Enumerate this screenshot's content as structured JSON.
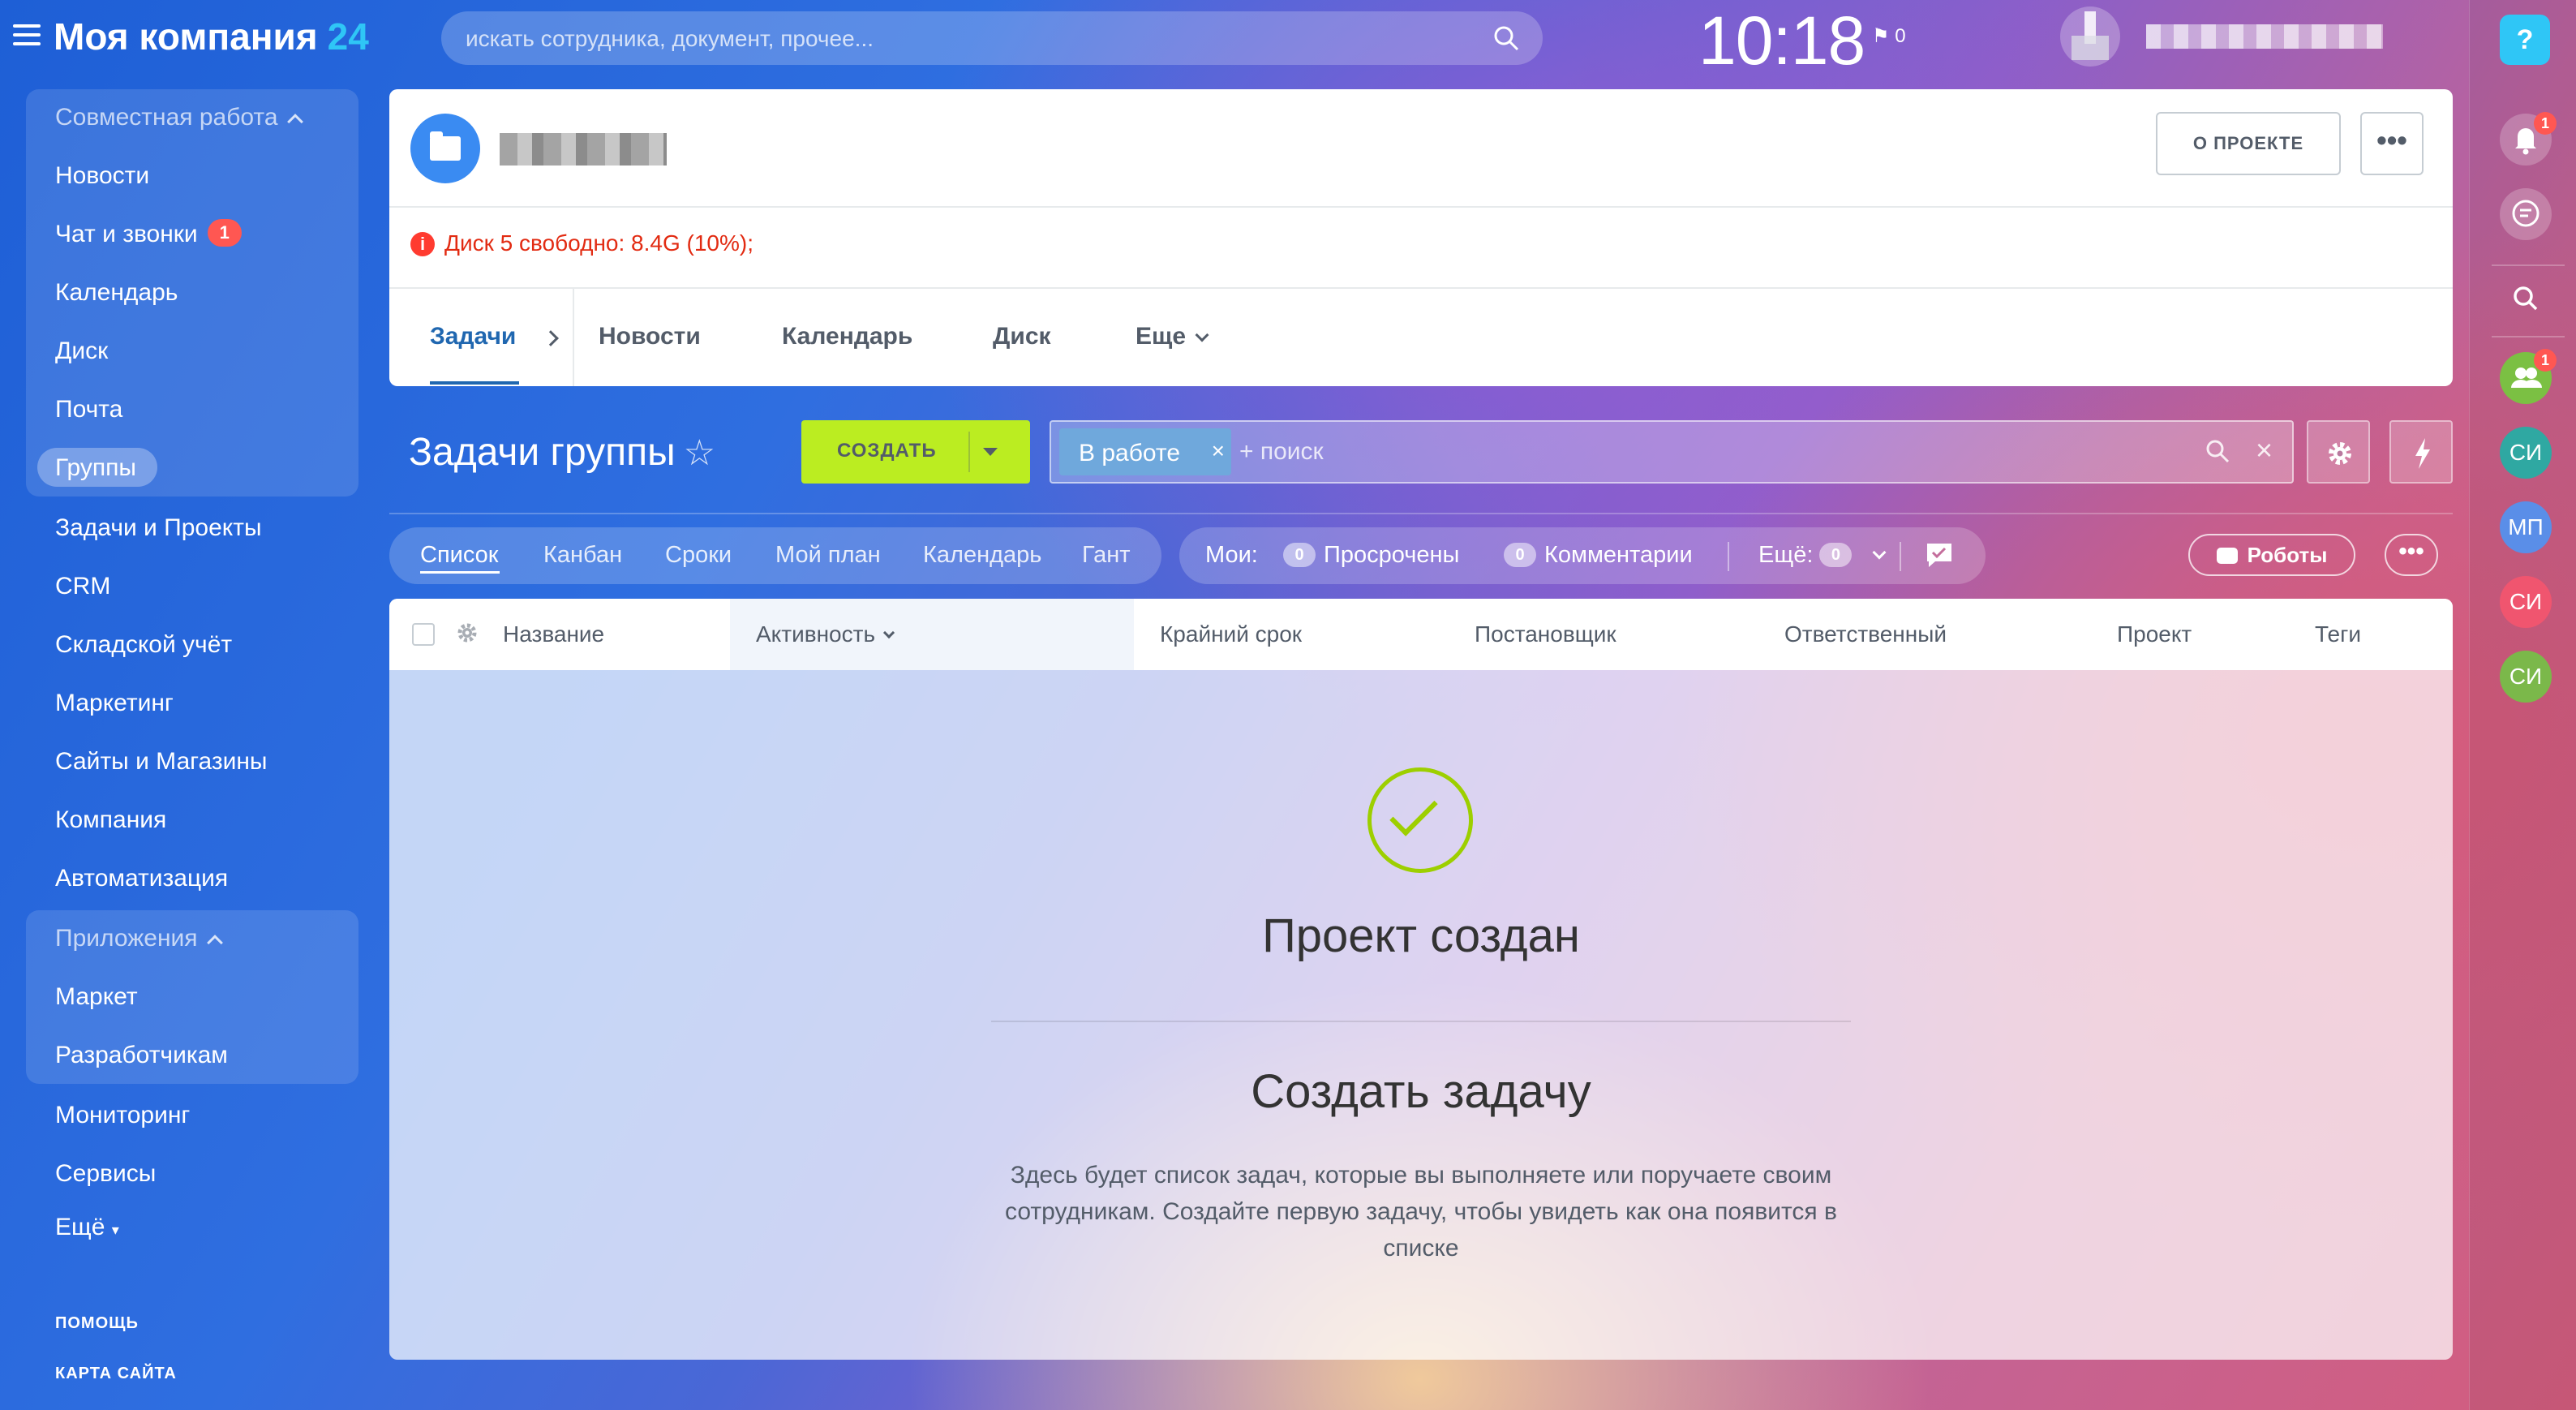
{
  "header": {
    "logo": "Моя компания",
    "logo_number": "24",
    "search_placeholder": "искать сотрудника, документ, прочее...",
    "time": "10:18",
    "flag_count": "0"
  },
  "sidebar": {
    "group1_title": "Совместная работа",
    "items": [
      {
        "label": "Новости"
      },
      {
        "label": "Чат и звонки",
        "badge": "1"
      },
      {
        "label": "Календарь"
      },
      {
        "label": "Диск"
      },
      {
        "label": "Почта"
      },
      {
        "label": "Группы"
      },
      {
        "label": "Задачи и Проекты"
      },
      {
        "label": "CRM"
      },
      {
        "label": "Складской учёт"
      },
      {
        "label": "Маркетинг"
      },
      {
        "label": "Сайты и Магазины"
      },
      {
        "label": "Компания"
      },
      {
        "label": "Автоматизация"
      }
    ],
    "group2_title": "Приложения",
    "apps": [
      {
        "label": "Маркет"
      },
      {
        "label": "Разработчикам"
      }
    ],
    "more_items": [
      {
        "label": "Мониторинг"
      },
      {
        "label": "Сервисы"
      },
      {
        "label": "Ещё"
      }
    ],
    "help": "ПОМОЩЬ",
    "sitemap": "КАРТА САЙТА"
  },
  "rightbar": {
    "help": "?",
    "notif_badge": "1",
    "group_badge": "1",
    "avatars": [
      "СИ",
      "МП",
      "СИ",
      "СИ"
    ],
    "avatar_colors": [
      "#2fa8a2",
      "#5a8ee8",
      "#f0556f",
      "#7bb84a"
    ]
  },
  "project": {
    "about_button": "О ПРОЕКТЕ",
    "more_button": "•••",
    "warning": "Диск 5 свободно: 8.4G (10%);",
    "tabs": [
      "Задачи",
      "Новости",
      "Календарь",
      "Диск",
      "Еще"
    ]
  },
  "tasks": {
    "title": "Задачи группы",
    "create_button": "СОЗДАТЬ",
    "filter_chip": "В работе",
    "filter_placeholder": "+ поиск",
    "views": [
      "Список",
      "Канбан",
      "Сроки",
      "Мой план",
      "Календарь",
      "Гант"
    ],
    "mine_label": "Мои:",
    "overdue_count": "0",
    "overdue_label": "Просрочены",
    "comments_count": "0",
    "comments_label": "Комментарии",
    "more_label": "Ещё:",
    "more_count": "0",
    "robots_button": "Роботы",
    "dots_button": "•••"
  },
  "table": {
    "columns": [
      "Название",
      "Активность",
      "Крайний срок",
      "Постановщик",
      "Ответственный",
      "Проект",
      "Теги"
    ]
  },
  "empty_state": {
    "title": "Проект создан",
    "subtitle": "Создать задачу",
    "description": "Здесь будет список задач, которые вы выполняете или поручаете своим сотрудникам. Создайте первую задачу, чтобы увидеть как она появится в списке"
  }
}
